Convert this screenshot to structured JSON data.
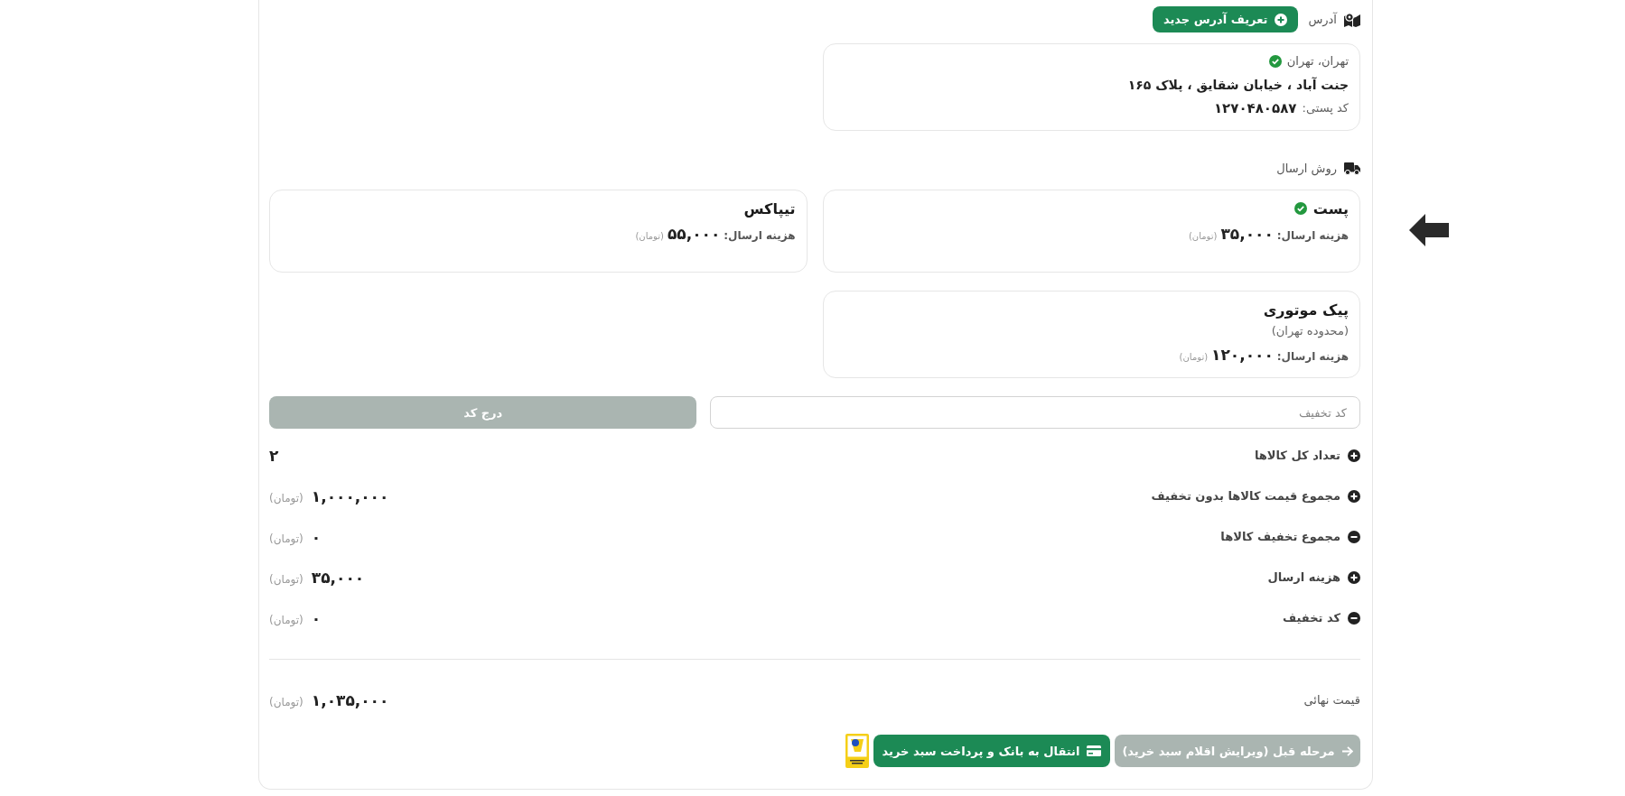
{
  "address_section": {
    "title": "آدرس",
    "add_button": "تعریف آدرس جدید",
    "addresses": [
      {
        "region": "تهران، تهران",
        "street": "جنت آباد ، خیابان شقایق ، پلاک ۱۶۵",
        "postal_code_label": "کد پستی:",
        "postal_code": "۱۲۷۰۴۸۰۵۸۷",
        "selected": true
      }
    ]
  },
  "shipping_section": {
    "title": "روش ارسال",
    "methods": [
      {
        "name": "پست",
        "cost_label": "هزینه ارسال:",
        "cost": "۳۵,۰۰۰",
        "currency": "(تومان)",
        "selected": true
      },
      {
        "name": "تیپاکس",
        "cost_label": "هزینه ارسال:",
        "cost": "۵۵,۰۰۰",
        "currency": "(تومان)",
        "selected": false
      },
      {
        "name": "پیک موتوری",
        "note": "(محدوده تهران)",
        "cost_label": "هزینه ارسال:",
        "cost": "۱۲۰,۰۰۰",
        "currency": "(تومان)",
        "selected": false
      }
    ]
  },
  "discount": {
    "placeholder": "کد تخفیف",
    "apply_button": "درج کد"
  },
  "summary": {
    "rows": [
      {
        "kind": "plus",
        "label": "تعداد کل کالاها",
        "value": "۲"
      },
      {
        "kind": "plus",
        "label": "مجموع قیمت کالاها بدون تخفیف",
        "value": "۱,۰۰۰,۰۰۰",
        "currency": "(تومان)"
      },
      {
        "kind": "minus",
        "label": "مجموع تخفیف کالاها",
        "value": "۰",
        "currency": "(تومان)"
      },
      {
        "kind": "plus",
        "label": "هزینه ارسال",
        "value": "۳۵,۰۰۰",
        "currency": "(تومان)"
      },
      {
        "kind": "minus",
        "label": "کد تخفیف",
        "value": "۰",
        "currency": "(تومان)"
      }
    ],
    "total": {
      "label": "قیمت نهائی",
      "value": "۱,۰۳۵,۰۰۰",
      "currency": "(تومان)"
    }
  },
  "actions": {
    "back_button": "مرحله قبل (ویرایش اقلام سبد خرید)",
    "pay_button": "انتقال به بانک و پرداخت سبد خرید"
  }
}
